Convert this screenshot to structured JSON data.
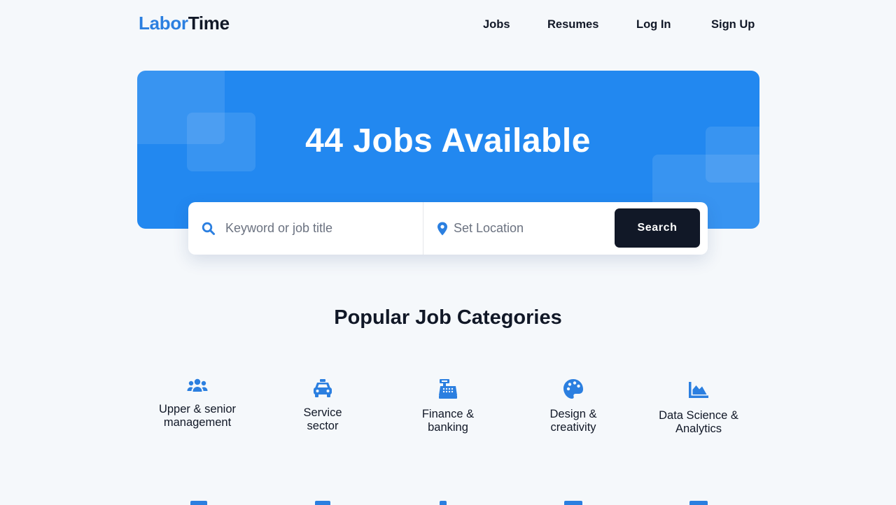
{
  "brand": {
    "part1": "Labor",
    "part2": "Time",
    "accent": "#2b7fe0"
  },
  "nav": {
    "items": [
      {
        "label": "Jobs"
      },
      {
        "label": "Resumes"
      },
      {
        "label": "Log In"
      },
      {
        "label": "Sign Up"
      }
    ]
  },
  "hero": {
    "job_count": 44,
    "title": "44 Jobs Available",
    "background": "#2288f0"
  },
  "search": {
    "keyword": {
      "icon": "search-icon",
      "placeholder": "Keyword or job title",
      "value": ""
    },
    "location": {
      "icon": "map-marker-icon",
      "placeholder": "Set Location",
      "value": ""
    },
    "button_label": "Search"
  },
  "categories": {
    "title": "Popular Job Categories",
    "items": [
      {
        "icon": "users-icon",
        "label": "Upper & senior management"
      },
      {
        "icon": "taxi-icon",
        "label": "Service sector"
      },
      {
        "icon": "cash-register-icon",
        "label": "Finance & banking"
      },
      {
        "icon": "palette-icon",
        "label": "Design & creativity"
      },
      {
        "icon": "chart-area-icon",
        "label": "Data Science & Analytics"
      }
    ]
  }
}
